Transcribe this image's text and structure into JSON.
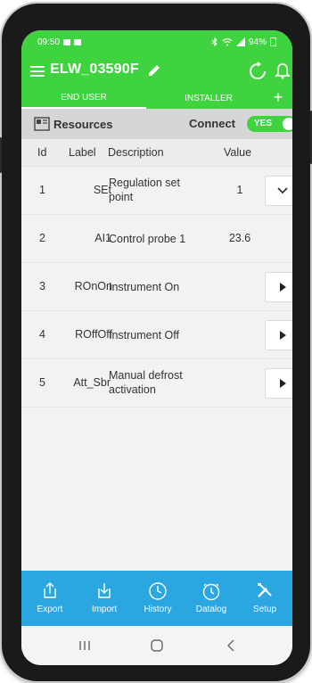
{
  "status_bar": {
    "time": "09:50",
    "battery": "94%"
  },
  "app_bar": {
    "device_name": "ELW_03590F",
    "icons": [
      "menu-icon",
      "pencil-icon",
      "refresh-icon",
      "bell-icon"
    ]
  },
  "tabs": [
    {
      "label": "END USER",
      "active": true
    },
    {
      "label": "INSTALLER",
      "active": false
    }
  ],
  "add_tab_label": "+",
  "resources_bar": {
    "title": "Resources",
    "connect_label": "Connect",
    "toggle_label": "YES",
    "toggle_on": true
  },
  "table": {
    "headers": {
      "id": "Id",
      "label": "Label",
      "description": "Description",
      "value": "Value"
    },
    "rows": [
      {
        "id": "1",
        "label": "SEt",
        "desc_line1": "Regulation set",
        "desc_line2": "point",
        "value": "1",
        "action": "chevron-down-icon"
      },
      {
        "id": "2",
        "label": "AI1",
        "desc_line1": "Control probe 1",
        "desc_line2": "",
        "value": "23.6",
        "action": ""
      },
      {
        "id": "3",
        "label": "ROnOn",
        "desc_line1": "Instrument On",
        "desc_line2": "",
        "value": "",
        "action": "play-icon"
      },
      {
        "id": "4",
        "label": "ROffOff",
        "desc_line1": "Instrument Off",
        "desc_line2": "",
        "value": "",
        "action": "play-icon"
      },
      {
        "id": "5",
        "label": "Att_Sbr",
        "desc_line1": "Manual defrost",
        "desc_line2": "activation",
        "value": "",
        "action": "play-icon"
      }
    ]
  },
  "bottom_nav": [
    {
      "label": "Export",
      "icon": "export-icon"
    },
    {
      "label": "Import",
      "icon": "import-icon"
    },
    {
      "label": "History",
      "icon": "history-icon"
    },
    {
      "label": "Datalog",
      "icon": "datalog-icon"
    },
    {
      "label": "Setup",
      "icon": "tools-icon"
    }
  ],
  "colors": {
    "primary_green": "#3fd43f",
    "nav_blue": "#2aa6e0",
    "header_gray": "#d6d6d6"
  }
}
